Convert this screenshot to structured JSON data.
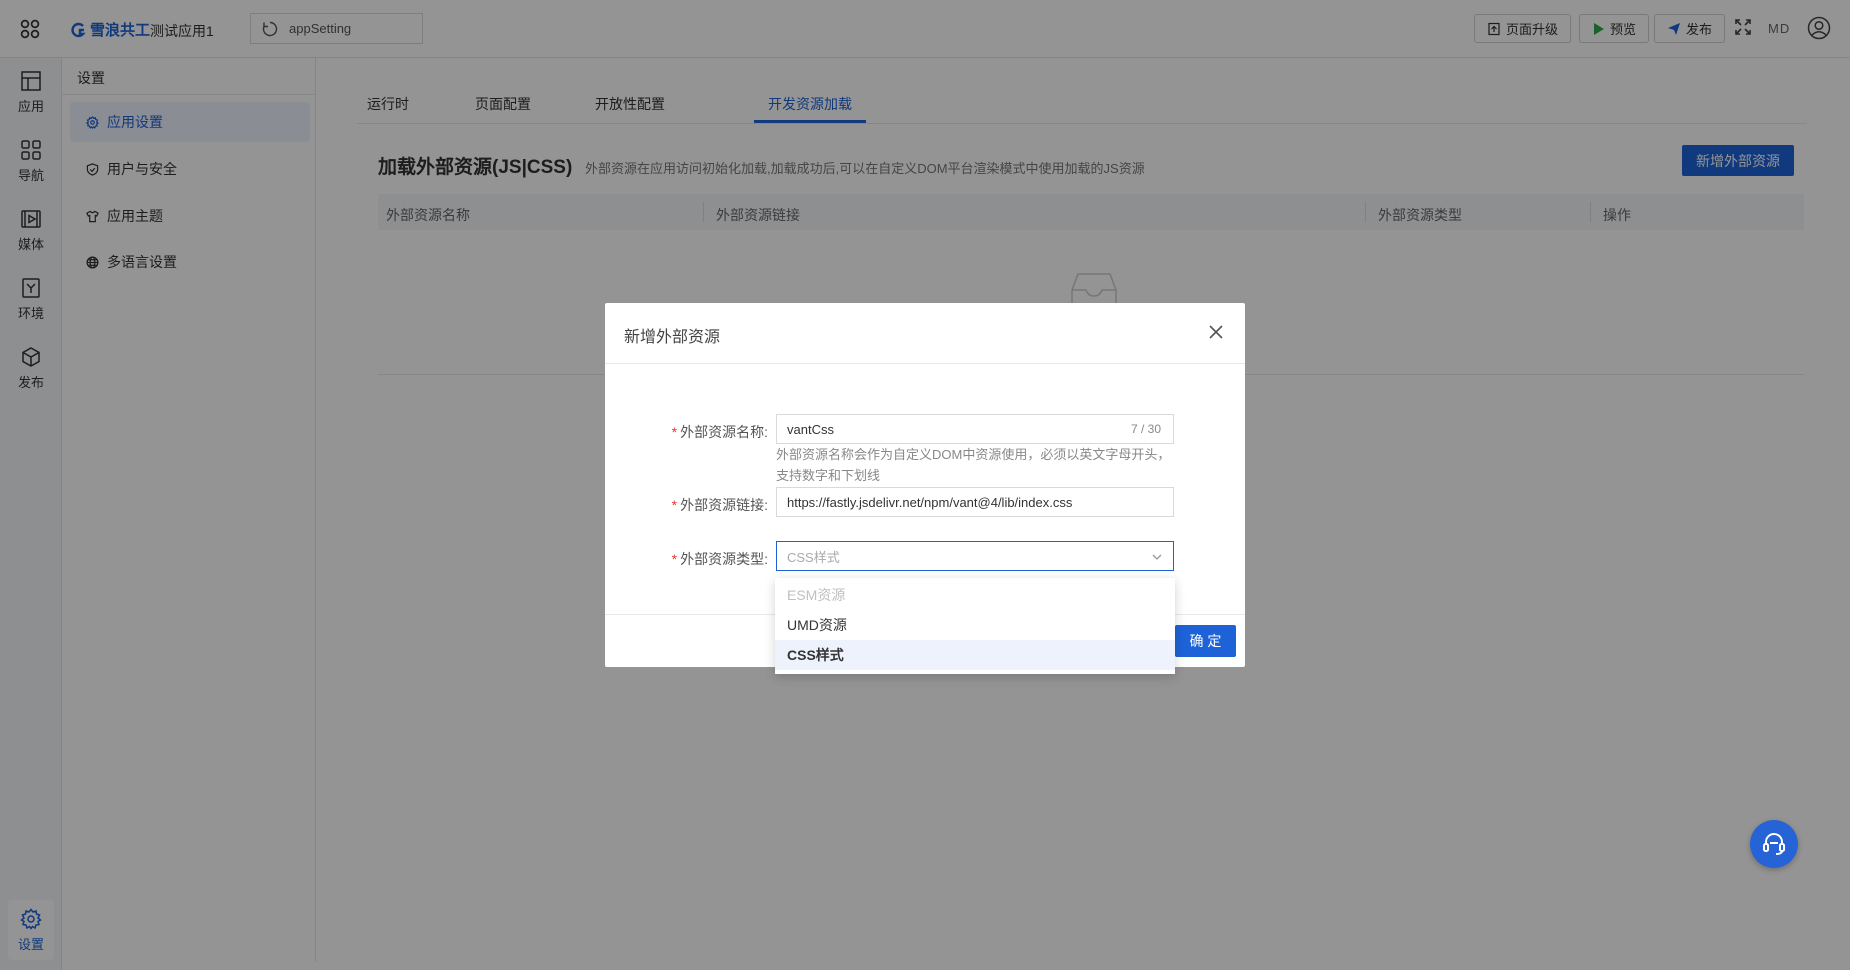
{
  "header": {
    "brand_name": "雪浪共工",
    "app_name": "测试应用1",
    "page_select_value": "appSetting",
    "upgrade_label": "页面升级",
    "preview_label": "预览",
    "publish_label": "发布",
    "user_initials": "MD"
  },
  "leftnav": {
    "items": [
      {
        "label": "应用",
        "icon": "layout-icon"
      },
      {
        "label": "导航",
        "icon": "grid-icon"
      },
      {
        "label": "媒体",
        "icon": "media-icon"
      },
      {
        "label": "环境",
        "icon": "environment-icon"
      },
      {
        "label": "发布",
        "icon": "cube-icon"
      }
    ],
    "settings": {
      "label": "设置",
      "icon": "gear-icon"
    }
  },
  "subnav": {
    "title": "设置",
    "items": [
      {
        "label": "应用设置",
        "icon": "gear-icon",
        "active": true
      },
      {
        "label": "用户与安全",
        "icon": "shield-icon"
      },
      {
        "label": "应用主题",
        "icon": "shirt-icon"
      },
      {
        "label": "多语言设置",
        "icon": "globe-icon"
      }
    ]
  },
  "main": {
    "tabs": [
      {
        "label": "运行时"
      },
      {
        "label": "页面配置"
      },
      {
        "label": "开放性配置"
      },
      {
        "label": "开发资源加载",
        "active": true
      }
    ],
    "section_title": "加载外部资源(JS|CSS)",
    "section_desc": "外部资源在应用访问初始化加载,加载成功后,可以在自定义DOM平台渲染模式中使用加载的JS资源",
    "add_button": "新增外部资源",
    "table_headers": [
      "外部资源名称",
      "外部资源链接",
      "外部资源类型",
      "操作"
    ]
  },
  "modal": {
    "title": "新增外部资源",
    "fields": {
      "name_label": "外部资源名称:",
      "name_value": "vantCss",
      "name_count": "7 / 30",
      "name_hint": "外部资源名称会作为自定义DOM中资源使用，必须以英文字母开头，支持数字和下划线",
      "link_label": "外部资源链接:",
      "link_value": "https://fastly.jsdelivr.net/npm/vant@4/lib/index.css",
      "type_label": "外部资源类型:",
      "type_value": "CSS样式"
    },
    "ok_label": "确 定",
    "required_mark": "*"
  },
  "dropdown": {
    "options": [
      {
        "label": "ESM资源",
        "disabled": true
      },
      {
        "label": "UMD资源"
      },
      {
        "label": "CSS样式",
        "selected": true
      }
    ]
  },
  "colors": {
    "accent": "#1e62d8",
    "required": "#e53935",
    "overlay": "rgba(0,0,0,0.42)"
  }
}
